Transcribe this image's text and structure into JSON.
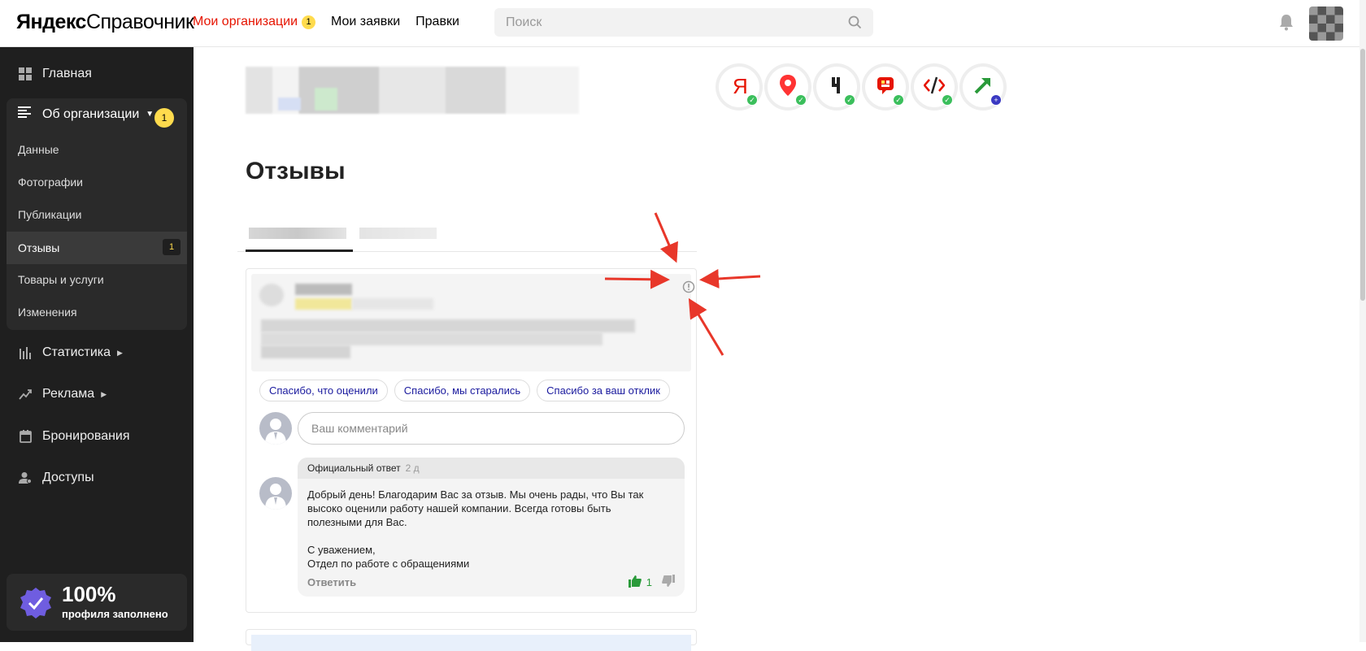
{
  "header": {
    "logo_part1": "Яндекс",
    "logo_part2": "Справочник",
    "nav": [
      {
        "label": "Мои организации",
        "badge": "1"
      },
      {
        "label": "Мои заявки"
      },
      {
        "label": "Правки"
      }
    ],
    "search_placeholder": "Поиск"
  },
  "sidebar": {
    "main": "Главная",
    "org": {
      "label": "Об организации",
      "badge": "1"
    },
    "sub_items": [
      {
        "label": "Данные"
      },
      {
        "label": "Фотографии"
      },
      {
        "label": "Публикации"
      },
      {
        "label": "Отзывы",
        "badge": "1"
      },
      {
        "label": "Товары и услуги"
      },
      {
        "label": "Изменения"
      }
    ],
    "stats": "Статистика",
    "ads": "Реклама",
    "booking": "Бронирования",
    "access": "Доступы",
    "profile_pct": "100%",
    "profile_label": "профиля заполнено"
  },
  "main": {
    "title": "Отзывы",
    "chips": [
      "Спасибо, что оценили",
      "Спасибо, мы старались",
      "Спасибо за ваш отклик"
    ],
    "comment_placeholder": "Ваш комментарий",
    "reply": {
      "head": "Официальный ответ",
      "time": "2 д",
      "line1": "Добрый день! Благодарим Вас за отзыв. Мы очень рады, что Вы так",
      "line2": "высоко оценили работу нашей компании. Всегда готовы быть",
      "line3": "полезными для Вас.",
      "line4": "С уважением,",
      "line5": "Отдел по работе с обращениями",
      "answer": "Ответить",
      "likes": "1"
    }
  },
  "colors": {
    "accent_red": "#e61400",
    "badge_yellow": "#ffdb4d",
    "sidebar_bg": "#1f1f1f",
    "ok_green": "#3bbf5c",
    "arrow_red": "#e8372a"
  },
  "icons": [
    "search-icon",
    "bell-icon",
    "grid-icon",
    "menu-icon",
    "bar-chart-icon",
    "trend-icon",
    "calendar-icon",
    "person-icon",
    "shield-check-icon",
    "warning-circle-icon",
    "thumb-up-icon",
    "thumb-down-icon"
  ]
}
